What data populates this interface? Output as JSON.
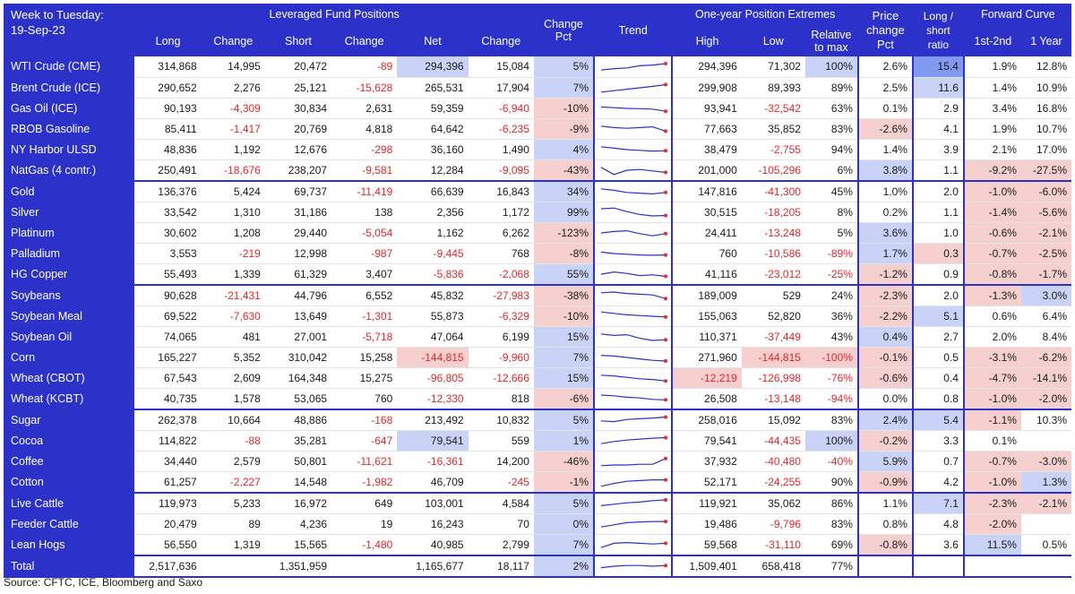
{
  "header": {
    "corner_line1": "Week to Tuesday:",
    "corner_line2": "19-Sep-23",
    "group_positions": "Leveraged Fund Positions",
    "group_extremes": "One-year Position Extremes",
    "group_price": "Price change Pct",
    "group_ratio": "Long / short ratio",
    "group_curve": "Forward Curve",
    "cols": {
      "long": "Long",
      "change1": "Change",
      "short": "Short",
      "change2": "Change",
      "net": "Net",
      "change3": "Change",
      "change_pct": "Change Pct",
      "trend": "Trend",
      "high": "High",
      "low": "Low",
      "relative": "Relative to max",
      "c1": "1st-2nd",
      "c2": "1 Year"
    }
  },
  "colors": {
    "header_blue": "#2b31c9",
    "negative_text": "#e8262b",
    "negative_fill": "#f6cfcf",
    "positive_fill": "#c9d3f7",
    "strong_fill": "#8199ee",
    "spark_line": "#2b31c9",
    "spark_dot": "#e8262b"
  },
  "rows": [
    {
      "name": "WTI Crude (CME)",
      "long": "314,868",
      "chg_long": "14,995",
      "short": "20,472",
      "chg_short": "-89",
      "net": "294,396",
      "chg_net": "15,084",
      "chg_pct": "5%",
      "trend": [
        0.3,
        0.4,
        0.45,
        0.6,
        0.65,
        0.75
      ],
      "high": "294,396",
      "low": "71,302",
      "rel": "100%",
      "price": "2.6%",
      "ratio": "15.4",
      "fc1": "1.9%",
      "fc2": "12.8%"
    },
    {
      "name": "Brent Crude (ICE)",
      "long": "290,652",
      "chg_long": "2,276",
      "short": "25,121",
      "chg_short": "-15,628",
      "net": "265,531",
      "chg_net": "17,904",
      "chg_pct": "7%",
      "trend": [
        0.2,
        0.3,
        0.4,
        0.5,
        0.6,
        0.72
      ],
      "high": "299,908",
      "low": "89,393",
      "rel": "89%",
      "price": "2.5%",
      "ratio": "11.6",
      "fc1": "1.4%",
      "fc2": "10.9%"
    },
    {
      "name": "Gas Oil (ICE)",
      "long": "90,193",
      "chg_long": "-4,309",
      "short": "30,834",
      "chg_short": "2,631",
      "net": "59,359",
      "chg_net": "-6,940",
      "chg_pct": "-10%",
      "trend": [
        0.6,
        0.55,
        0.5,
        0.48,
        0.45,
        0.3
      ],
      "high": "93,941",
      "low": "-32,542",
      "rel": "63%",
      "price": "0.1%",
      "ratio": "2.9",
      "fc1": "3.4%",
      "fc2": "16.8%"
    },
    {
      "name": "RBOB Gasoline",
      "long": "85,411",
      "chg_long": "-1,417",
      "short": "20,769",
      "chg_short": "4,818",
      "net": "64,642",
      "chg_net": "-6,235",
      "chg_pct": "-9%",
      "trend": [
        0.7,
        0.6,
        0.55,
        0.6,
        0.65,
        0.35
      ],
      "high": "77,663",
      "low": "35,852",
      "rel": "83%",
      "price": "-2.6%",
      "ratio": "4.1",
      "fc1": "1.9%",
      "fc2": "10.7%"
    },
    {
      "name": "NY Harbor ULSD",
      "long": "48,836",
      "chg_long": "1,192",
      "short": "12,676",
      "chg_short": "-298",
      "net": "36,160",
      "chg_net": "1,490",
      "chg_pct": "4%",
      "trend": [
        0.7,
        0.6,
        0.5,
        0.45,
        0.4,
        0.42
      ],
      "high": "38,479",
      "low": "-2,755",
      "rel": "94%",
      "price": "1.4%",
      "ratio": "3.9",
      "fc1": "2.1%",
      "fc2": "17.0%"
    },
    {
      "name": "NatGas (4 contr.)",
      "long": "250,491",
      "chg_long": "-18,676",
      "short": "238,207",
      "chg_short": "-9,581",
      "net": "12,284",
      "chg_net": "-9,095",
      "chg_pct": "-43%",
      "trend": [
        0.7,
        0.2,
        0.5,
        0.55,
        0.45,
        0.35
      ],
      "high": "201,000",
      "low": "-105,296",
      "rel": "6%",
      "price": "3.8%",
      "ratio": "1.1",
      "fc1": "-9.2%",
      "fc2": "-27.5%",
      "grp_end": true
    },
    {
      "name": "Gold",
      "long": "136,376",
      "chg_long": "5,424",
      "short": "69,737",
      "chg_short": "-11,419",
      "net": "66,639",
      "chg_net": "16,843",
      "chg_pct": "34%",
      "trend": [
        0.7,
        0.6,
        0.45,
        0.4,
        0.35,
        0.45
      ],
      "high": "147,816",
      "low": "-41,300",
      "rel": "45%",
      "price": "1.0%",
      "ratio": "2.0",
      "fc1": "-1.0%",
      "fc2": "-6.0%"
    },
    {
      "name": "Silver",
      "long": "33,542",
      "chg_long": "1,310",
      "short": "31,186",
      "chg_short": "138",
      "net": "2,356",
      "chg_net": "1,172",
      "chg_pct": "99%",
      "trend": [
        0.75,
        0.8,
        0.55,
        0.35,
        0.25,
        0.28
      ],
      "high": "30,515",
      "low": "-18,205",
      "rel": "8%",
      "price": "0.2%",
      "ratio": "1.1",
      "fc1": "-1.4%",
      "fc2": "-5.6%"
    },
    {
      "name": "Platinum",
      "long": "30,602",
      "chg_long": "1,208",
      "short": "29,440",
      "chg_short": "-5,054",
      "net": "1,162",
      "chg_net": "6,262",
      "chg_pct": "-123%",
      "trend": [
        0.5,
        0.6,
        0.65,
        0.45,
        0.3,
        0.45
      ],
      "high": "24,411",
      "low": "-13,248",
      "rel": "5%",
      "price": "3.6%",
      "ratio": "1.0",
      "fc1": "-0.6%",
      "fc2": "-2.1%"
    },
    {
      "name": "Palladium",
      "long": "3,553",
      "chg_long": "-219",
      "short": "12,998",
      "chg_short": "-987",
      "net": "-9,445",
      "chg_net": "768",
      "chg_pct": "-8%",
      "trend": [
        0.6,
        0.5,
        0.45,
        0.4,
        0.38,
        0.4
      ],
      "high": "760",
      "low": "-10,586",
      "rel": "-89%",
      "price": "1.7%",
      "ratio": "0.3",
      "fc1": "-0.7%",
      "fc2": "-2.5%"
    },
    {
      "name": "HG Copper",
      "long": "55,493",
      "chg_long": "1,339",
      "short": "61,329",
      "chg_short": "3,407",
      "net": "-5,836",
      "chg_net": "-2,068",
      "chg_pct": "55%",
      "trend": [
        0.5,
        0.65,
        0.55,
        0.4,
        0.45,
        0.35
      ],
      "high": "41,116",
      "low": "-23,012",
      "rel": "-25%",
      "price": "-1.2%",
      "ratio": "0.9",
      "fc1": "-0.8%",
      "fc2": "-1.7%",
      "grp_end": true
    },
    {
      "name": "Soybeans",
      "long": "90,628",
      "chg_long": "-21,431",
      "short": "44,796",
      "chg_short": "6,552",
      "net": "45,832",
      "chg_net": "-27,983",
      "chg_pct": "-38%",
      "trend": [
        0.7,
        0.75,
        0.65,
        0.6,
        0.55,
        0.3
      ],
      "high": "189,009",
      "low": "529",
      "rel": "24%",
      "price": "-2.3%",
      "ratio": "2.0",
      "fc1": "-1.3%",
      "fc2": "3.0%"
    },
    {
      "name": "Soybean Meal",
      "long": "69,522",
      "chg_long": "-7,630",
      "short": "13,649",
      "chg_short": "-1,301",
      "net": "55,873",
      "chg_net": "-6,329",
      "chg_pct": "-10%",
      "trend": [
        0.8,
        0.7,
        0.6,
        0.55,
        0.5,
        0.45
      ],
      "high": "155,063",
      "low": "52,820",
      "rel": "36%",
      "price": "-2.2%",
      "ratio": "5.1",
      "fc1": "0.6%",
      "fc2": "6.4%"
    },
    {
      "name": "Soybean Oil",
      "long": "74,065",
      "chg_long": "481",
      "short": "27,001",
      "chg_short": "-5,718",
      "net": "47,064",
      "chg_net": "6,199",
      "chg_pct": "15%",
      "trend": [
        0.7,
        0.6,
        0.65,
        0.4,
        0.25,
        0.3
      ],
      "high": "110,371",
      "low": "-37,449",
      "rel": "43%",
      "price": "0.4%",
      "ratio": "2.7",
      "fc1": "2.0%",
      "fc2": "8.4%"
    },
    {
      "name": "Corn",
      "long": "165,227",
      "chg_long": "5,352",
      "short": "310,042",
      "chg_short": "15,258",
      "net": "-144,815",
      "chg_net": "-9,960",
      "chg_pct": "7%",
      "trend": [
        0.65,
        0.6,
        0.5,
        0.4,
        0.3,
        0.25
      ],
      "high": "271,960",
      "low": "-144,815",
      "rel": "-100%",
      "price": "-0.1%",
      "ratio": "0.5",
      "fc1": "-3.1%",
      "fc2": "-6.2%"
    },
    {
      "name": "Wheat (CBOT)",
      "long": "67,543",
      "chg_long": "2,609",
      "short": "164,348",
      "chg_short": "15,275",
      "net": "-96,805",
      "chg_net": "-12,666",
      "chg_pct": "15%",
      "trend": [
        0.7,
        0.65,
        0.55,
        0.45,
        0.4,
        0.3
      ],
      "high": "-12,219",
      "low": "-126,998",
      "rel": "-76%",
      "price": "-0.6%",
      "ratio": "0.4",
      "fc1": "-4.7%",
      "fc2": "-14.1%"
    },
    {
      "name": "Wheat (KCBT)",
      "long": "40,735",
      "chg_long": "1,578",
      "short": "53,065",
      "chg_short": "760",
      "net": "-12,330",
      "chg_net": "818",
      "chg_pct": "-6%",
      "trend": [
        0.75,
        0.7,
        0.6,
        0.55,
        0.45,
        0.42
      ],
      "high": "26,508",
      "low": "-13,148",
      "rel": "-94%",
      "price": "0.0%",
      "ratio": "0.8",
      "fc1": "-1.0%",
      "fc2": "-2.0%",
      "grp_end": true
    },
    {
      "name": "Sugar",
      "long": "262,378",
      "chg_long": "10,664",
      "short": "48,886",
      "chg_short": "-168",
      "net": "213,492",
      "chg_net": "10,832",
      "chg_pct": "5%",
      "trend": [
        0.45,
        0.4,
        0.55,
        0.6,
        0.65,
        0.72
      ],
      "high": "258,016",
      "low": "15,092",
      "rel": "83%",
      "price": "2.4%",
      "ratio": "5.4",
      "fc1": "-1.1%",
      "fc2": "10.3%"
    },
    {
      "name": "Cocoa",
      "long": "114,822",
      "chg_long": "-88",
      "short": "35,281",
      "chg_short": "-647",
      "net": "79,541",
      "chg_net": "559",
      "chg_pct": "1%",
      "trend": [
        0.3,
        0.45,
        0.55,
        0.62,
        0.68,
        0.72
      ],
      "high": "79,541",
      "low": "-44,435",
      "rel": "100%",
      "price": "-0.2%",
      "ratio": "3.3",
      "fc1": "0.1%",
      "fc2": ""
    },
    {
      "name": "Coffee",
      "long": "34,440",
      "chg_long": "2,579",
      "short": "50,801",
      "chg_short": "-11,621",
      "net": "-16,361",
      "chg_net": "14,200",
      "chg_pct": "-46%",
      "trend": [
        0.2,
        0.25,
        0.25,
        0.3,
        0.3,
        0.7
      ],
      "high": "37,932",
      "low": "-40,480",
      "rel": "-40%",
      "price": "5.9%",
      "ratio": "0.7",
      "fc1": "-0.7%",
      "fc2": "-3.0%"
    },
    {
      "name": "Cotton",
      "long": "61,257",
      "chg_long": "-2,227",
      "short": "14,548",
      "chg_short": "-1,982",
      "net": "46,709",
      "chg_net": "-245",
      "chg_pct": "-1%",
      "trend": [
        0.2,
        0.4,
        0.55,
        0.6,
        0.65,
        0.65
      ],
      "high": "52,171",
      "low": "-24,255",
      "rel": "90%",
      "price": "-0.9%",
      "ratio": "4.2",
      "fc1": "-1.0%",
      "fc2": "1.3%",
      "grp_end": true
    },
    {
      "name": "Live Cattle",
      "long": "119,973",
      "chg_long": "5,233",
      "short": "16,972",
      "chg_short": "649",
      "net": "103,001",
      "chg_net": "4,584",
      "chg_pct": "5%",
      "trend": [
        0.35,
        0.45,
        0.55,
        0.6,
        0.7,
        0.75
      ],
      "high": "119,921",
      "low": "35,062",
      "rel": "86%",
      "price": "1.1%",
      "ratio": "7.1",
      "fc1": "-2.3%",
      "fc2": "-2.1%"
    },
    {
      "name": "Feeder Cattle",
      "long": "20,479",
      "chg_long": "89",
      "short": "4,236",
      "chg_short": "19",
      "net": "16,243",
      "chg_net": "70",
      "chg_pct": "0%",
      "trend": [
        0.3,
        0.45,
        0.6,
        0.65,
        0.68,
        0.68
      ],
      "high": "19,486",
      "low": "-9,796",
      "rel": "83%",
      "price": "0.8%",
      "ratio": "4.8",
      "fc1": "-2.0%",
      "fc2": ""
    },
    {
      "name": "Lean Hogs",
      "long": "56,550",
      "chg_long": "1,319",
      "short": "15,565",
      "chg_short": "-1,480",
      "net": "40,985",
      "chg_net": "2,799",
      "chg_pct": "7%",
      "trend": [
        0.3,
        0.6,
        0.65,
        0.6,
        0.55,
        0.6
      ],
      "high": "59,568",
      "low": "-31,110",
      "rel": "69%",
      "price": "-0.8%",
      "ratio": "3.6",
      "fc1": "11.5%",
      "fc2": "0.5%",
      "grp_end": true
    },
    {
      "name": "Total",
      "long": "2,517,636",
      "chg_long": "",
      "short": "1,351,959",
      "chg_short": "",
      "net": "1,165,677",
      "chg_net": "18,117",
      "chg_pct": "2%",
      "trend": [
        0.4,
        0.5,
        0.55,
        0.55,
        0.5,
        0.55
      ],
      "high": "1,509,401",
      "low": "658,418",
      "rel": "77%",
      "price": "",
      "ratio": "",
      "fc1": "",
      "fc2": "",
      "total": true
    }
  ],
  "fills": {
    "chg_pct_pos": [
      "WTI Crude (CME)",
      "Brent Crude (ICE)",
      "NY Harbor ULSD",
      "Gold",
      "Silver",
      "HG Copper",
      "Soybean Oil",
      "Corn",
      "Wheat (CBOT)",
      "Sugar",
      "Cocoa",
      "Live Cattle",
      "Feeder Cattle",
      "Lean Hogs",
      "Total"
    ],
    "chg_pct_neg": [
      "Gas Oil (ICE)",
      "RBOB Gasoline",
      "NatGas (4 contr.)",
      "Platinum",
      "Palladium",
      "Soybeans",
      "Soybean Meal",
      "Wheat (KCBT)",
      "Coffee",
      "Cotton"
    ],
    "net_pos": [
      "WTI Crude (CME)",
      "Cocoa"
    ],
    "net_neg": [
      "Corn"
    ],
    "high_neg": [
      "Wheat (CBOT)"
    ],
    "low_neg": [
      "Corn"
    ],
    "rel_pos": [
      "WTI Crude (CME)",
      "Cocoa"
    ],
    "rel_neg": [
      "Corn"
    ],
    "price_pos": [
      "Coffee"
    ],
    "price_neg": [
      "RBOB Gasoline",
      "HG Copper",
      "Soybeans",
      "Soybean Meal",
      "Corn",
      "Wheat (CBOT)",
      "Cocoa",
      "Cotton",
      "Lean Hogs"
    ],
    "price_lightpos": [
      "NatGas (4 contr.)",
      "Platinum",
      "Palladium",
      "Soybean Oil",
      "Sugar"
    ],
    "ratio_strong": [
      "WTI Crude (CME)"
    ],
    "ratio_pos": [
      "Brent Crude (ICE)",
      "Soybean Meal",
      "Live Cattle",
      "Sugar"
    ],
    "ratio_neg": [
      "Palladium"
    ],
    "fc1_neg": [
      "NatGas (4 contr.)",
      "Gold",
      "Silver",
      "Platinum",
      "Palladium",
      "HG Copper",
      "Soybeans",
      "Corn",
      "Wheat (CBOT)",
      "Wheat (KCBT)",
      "Sugar",
      "Coffee",
      "Cotton",
      "Live Cattle",
      "Feeder Cattle"
    ],
    "fc1_pos": [
      "Lean Hogs"
    ],
    "fc2_neg": [
      "NatGas (4 contr.)",
      "Gold",
      "Silver",
      "Platinum",
      "Palladium",
      "HG Copper",
      "Corn",
      "Wheat (CBOT)",
      "Wheat (KCBT)",
      "Coffee",
      "Live Cattle"
    ],
    "fc2_pos": [
      "Soybeans",
      "Cotton"
    ]
  },
  "source": "Source: CFTC, ICE, Bloomberg and Saxo"
}
